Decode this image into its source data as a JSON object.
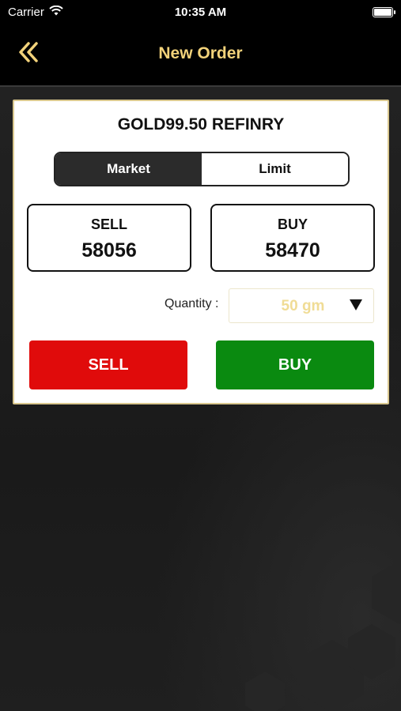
{
  "status_bar": {
    "carrier": "Carrier",
    "time": "10:35 AM"
  },
  "nav": {
    "title": "New Order"
  },
  "order": {
    "symbol": "GOLD99.50 REFINRY",
    "tabs": [
      {
        "label": "Market",
        "active": true
      },
      {
        "label": "Limit",
        "active": false
      }
    ],
    "sell": {
      "label": "SELL",
      "price": "58056"
    },
    "buy": {
      "label": "BUY",
      "price": "58470"
    },
    "quantity": {
      "label": "Quantity :",
      "value": "50 gm"
    },
    "sell_button": "SELL",
    "buy_button": "BUY"
  },
  "colors": {
    "accent_gold": "#f2d27a",
    "sell_red": "#e00b0b",
    "buy_green": "#0a8a10"
  }
}
